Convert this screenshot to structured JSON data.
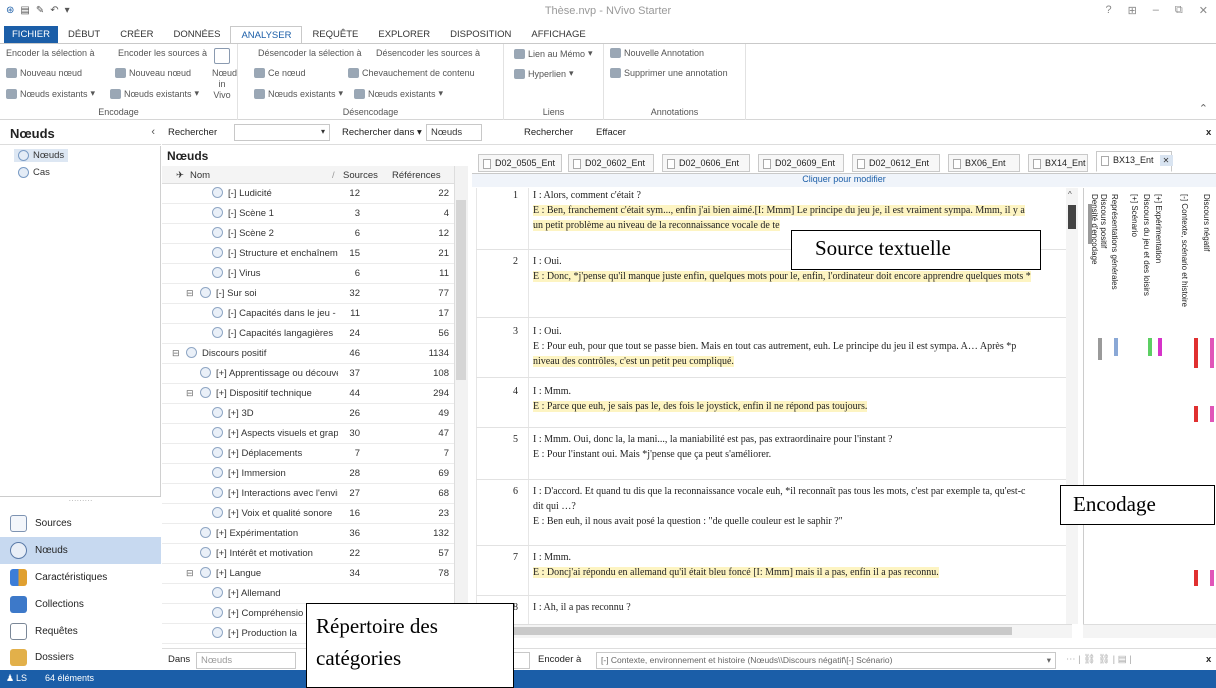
{
  "window": {
    "title": "Thèse.nvp - NVivo Starter",
    "controls": [
      "?",
      "⊞",
      "–",
      "⧉",
      "✕"
    ]
  },
  "ribbon_tabs": [
    "FICHIER",
    "DÉBUT",
    "CRÉER",
    "DONNÉES",
    "ANALYSER",
    "REQUÊTE",
    "EXPLORER",
    "DISPOSITION",
    "AFFICHAGE"
  ],
  "ribbon": {
    "encodage": {
      "l1": "Encoder la sélection à",
      "l1b": "Encoder les sources à",
      "l2": "Nouveau nœud",
      "l2b": "Nouveau nœud",
      "l3": "Nœuds existants",
      "l3b": "Nœuds existants",
      "invivo1": "Nœud",
      "invivo2": "in Vivo",
      "label": "Encodage"
    },
    "desencodage": {
      "l1": "Désencoder la sélection à",
      "l1b": "Désencoder les sources à",
      "l2": "Ce nœud",
      "l2b": "Chevauchement de contenu",
      "l3": "Nœuds existants",
      "l3b": "Nœuds existants",
      "label": "Désencodage"
    },
    "liens": {
      "l1": "Lien au Mémo",
      "l2": "Hyperlien",
      "label": "Liens"
    },
    "annotations": {
      "l1": "Nouvelle Annotation",
      "l2": "Supprimer une annotation",
      "label": "Annotations"
    }
  },
  "nav": {
    "title": "Nœuds",
    "tree": [
      "Nœuds",
      "Cas"
    ],
    "buttons": [
      "Sources",
      "Nœuds",
      "Caractéristiques",
      "Collections",
      "Requêtes",
      "Dossiers"
    ]
  },
  "search": {
    "label": "Rechercher",
    "search_in": "Rechercher dans",
    "search_in_value": "Nœuds",
    "search_btn": "Rechercher",
    "clear_btn": "Effacer",
    "close": "x"
  },
  "nodes": {
    "title": "Nœuds",
    "columns": {
      "name": "Nom",
      "sources": "Sources",
      "refs": "Références"
    },
    "rows": [
      {
        "indent": 2,
        "toggle": "",
        "label": "[-] Ludicité",
        "src": "12",
        "ref": "22"
      },
      {
        "indent": 2,
        "toggle": "",
        "label": "[-] Scène 1",
        "src": "3",
        "ref": "4"
      },
      {
        "indent": 2,
        "toggle": "",
        "label": "[-] Scène 2",
        "src": "6",
        "ref": "12"
      },
      {
        "indent": 2,
        "toggle": "",
        "label": "[-] Structure et enchaînem",
        "src": "15",
        "ref": "21"
      },
      {
        "indent": 2,
        "toggle": "",
        "label": "[-] Virus",
        "src": "6",
        "ref": "11"
      },
      {
        "indent": 1,
        "toggle": "⊟",
        "label": "[-] Sur soi",
        "src": "32",
        "ref": "77"
      },
      {
        "indent": 2,
        "toggle": "",
        "label": "[-] Capacités dans le jeu -",
        "src": "11",
        "ref": "17"
      },
      {
        "indent": 2,
        "toggle": "",
        "label": "[-] Capacités langagières",
        "src": "24",
        "ref": "56"
      },
      {
        "indent": 0,
        "toggle": "⊟",
        "label": "Discours positif",
        "src": "46",
        "ref": "1134"
      },
      {
        "indent": 1,
        "toggle": "",
        "label": "[+] Apprentissage ou découve",
        "src": "37",
        "ref": "108"
      },
      {
        "indent": 1,
        "toggle": "⊟",
        "label": "[+] Dispositif technique",
        "src": "44",
        "ref": "294"
      },
      {
        "indent": 2,
        "toggle": "",
        "label": "[+] 3D",
        "src": "26",
        "ref": "49"
      },
      {
        "indent": 2,
        "toggle": "",
        "label": "[+] Aspects visuels et grap",
        "src": "30",
        "ref": "47"
      },
      {
        "indent": 2,
        "toggle": "",
        "label": "[+] Déplacements",
        "src": "7",
        "ref": "7"
      },
      {
        "indent": 2,
        "toggle": "",
        "label": "[+] Immersion",
        "src": "28",
        "ref": "69"
      },
      {
        "indent": 2,
        "toggle": "",
        "label": "[+] Interactions avec l'envir",
        "src": "27",
        "ref": "68"
      },
      {
        "indent": 2,
        "toggle": "",
        "label": "[+] Voix et qualité sonore",
        "src": "16",
        "ref": "23"
      },
      {
        "indent": 1,
        "toggle": "",
        "label": "[+] Expérimentation",
        "src": "36",
        "ref": "132"
      },
      {
        "indent": 1,
        "toggle": "",
        "label": "[+] Intérêt et motivation",
        "src": "22",
        "ref": "57"
      },
      {
        "indent": 1,
        "toggle": "⊟",
        "label": "[+] Langue",
        "src": "34",
        "ref": "78"
      },
      {
        "indent": 2,
        "toggle": "",
        "label": "[+] Allemand",
        "src": "",
        "ref": ""
      },
      {
        "indent": 2,
        "toggle": "",
        "label": "[+] Compréhensio",
        "src": "",
        "ref": ""
      },
      {
        "indent": 2,
        "toggle": "",
        "label": "[+] Production la",
        "src": "",
        "ref": ""
      }
    ]
  },
  "doc_tabs": [
    "D02_0505_Ent",
    "D02_0602_Ent",
    "D02_0606_Ent",
    "D02_0609_Ent",
    "D02_0612_Ent",
    "BX06_Ent",
    "BX14_Ent",
    "BX13_Ent"
  ],
  "click_to_edit": "Cliquer pour modifier",
  "transcript": [
    {
      "num": "1",
      "lines": [
        {
          "text": "I :  Alors, comment c'était ?",
          "hl": false
        },
        {
          "text": "E : Ben, franchement c'était sym..., enfin j'ai bien aimé.[I: Mmm] Le principe du jeu je, il est vraiment sympa. Mmm, il y a",
          "hl": true
        },
        {
          "text": "un petit problème au niveau de la reconnaissance vocale de te",
          "hl": true
        }
      ]
    },
    {
      "num": "2",
      "lines": [
        {
          "text": "I : Oui.",
          "hl": false
        },
        {
          "text": "E : Donc, *j'pense qu'il manque juste enfin, quelques mots pour le, enfin, l'ordinateur doit encore apprendre quelques mots *",
          "hl": true
        }
      ]
    },
    {
      "num": "3",
      "lines": [
        {
          "text": "I : Oui.",
          "hl": false
        },
        {
          "text": "E : Pour euh, pour que tout se passe bien. Mais en tout cas autrement, euh. Le principe du jeu il est sympa. A… Après *p",
          "hl": false
        },
        {
          "text": "niveau des contrôles, c'est un petit peu compliqué.",
          "hl": true
        }
      ]
    },
    {
      "num": "4",
      "lines": [
        {
          "text": "I : Mmm.",
          "hl": false
        },
        {
          "text": "E : Parce que euh, je sais pas le, des fois le joystick, enfin il ne répond pas toujours.",
          "hl": true
        }
      ]
    },
    {
      "num": "5",
      "lines": [
        {
          "text": "I : Mmm. Oui, donc la, la mani..., la maniabilité est pas, pas extraordinaire pour l'instant ?",
          "hl": false
        },
        {
          "text": "E : Pour l'instant oui. Mais *j'pense que ça peut s'améliorer.",
          "hl": false
        }
      ]
    },
    {
      "num": "6",
      "lines": [
        {
          "text": "I : D'accord. Et quand tu dis que la reconnaissance vocale euh, *il reconnaît pas tous les mots, c'est par exemple ta, qu'est-c",
          "hl": false
        },
        {
          "text": "dit qui …?",
          "hl": false
        },
        {
          "text": "E : Ben euh, il nous avait posé la question : \"de quelle couleur est le saphir ?\"",
          "hl": false
        }
      ]
    },
    {
      "num": "7",
      "lines": [
        {
          "text": "I : Mmm.",
          "hl": false
        },
        {
          "text": "E : Doncj'ai répondu en allemand qu'il était bleu foncé [I: Mmm] mais il a pas, enfin il a pas reconnu.",
          "hl": true
        }
      ]
    },
    {
      "num": "8",
      "lines": [
        {
          "text": "I : Ah, il a pas reconnu ?",
          "hl": false
        }
      ]
    }
  ],
  "stripes": {
    "headers": [
      "Densité d'encodage",
      "Discours positif",
      "Représentations générales",
      "[+] Scénario",
      "Discours du jeu et des loisirs",
      "[+] Expérimentation",
      "[-] Contexte, scénario et histoire",
      "Discours négatif"
    ],
    "colors": {
      "gray": "#9a9a9a",
      "magenta": "#d633c9",
      "blue": "#8aa8d6",
      "green": "#5ccf63",
      "red": "#e03030",
      "pink": "#e055b8"
    }
  },
  "bottom": {
    "dans": "Dans",
    "dans_value": "Nœuds",
    "encoder_a": "Encoder à",
    "encoder_value": "[-] Contexte, environnement et histoire (Nœuds\\\\Discours négatif\\[-] Scénario)",
    "close": "x"
  },
  "status": {
    "user": "LS",
    "count": "64 éléments"
  },
  "annotations": {
    "source": "Source textuelle",
    "encodage": "Encodage",
    "repertoire1": "Répertoire des",
    "repertoire2": "catégories"
  }
}
